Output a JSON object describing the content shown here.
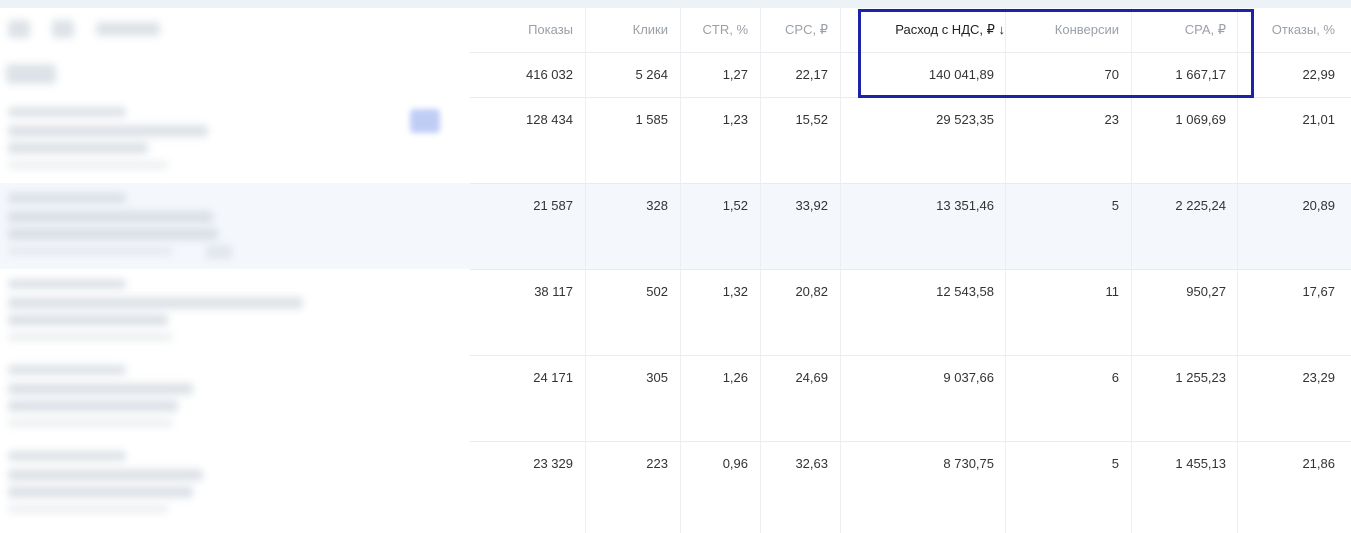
{
  "table": {
    "headers": [
      "Показы",
      "Клики",
      "CTR, %",
      "CPC, ₽",
      "Расход с НДС, ₽ ↓",
      "Конверсии",
      "CPA, ₽",
      "Отказы, %"
    ],
    "total": [
      "416 032",
      "5 264",
      "1,27",
      "22,17",
      "140 041,89",
      "70",
      "1 667,17",
      "22,99"
    ],
    "rows": [
      [
        "128 434",
        "1 585",
        "1,23",
        "15,52",
        "29 523,35",
        "23",
        "1 069,69",
        "21,01"
      ],
      [
        "21 587",
        "328",
        "1,52",
        "33,92",
        "13 351,46",
        "5",
        "2 225,24",
        "20,89"
      ],
      [
        "38 117",
        "502",
        "1,32",
        "20,82",
        "12 543,58",
        "11",
        "950,27",
        "17,67"
      ],
      [
        "24 171",
        "305",
        "1,26",
        "24,69",
        "9 037,66",
        "6",
        "1 255,23",
        "23,29"
      ],
      [
        "23 329",
        "223",
        "0,96",
        "32,63",
        "8 730,75",
        "5",
        "1 455,13",
        "21,86"
      ]
    ]
  },
  "colors": {
    "accent_box": "#1b24a6",
    "header_text": "#9aa0a8",
    "row_highlight": "#f4f7fb"
  }
}
